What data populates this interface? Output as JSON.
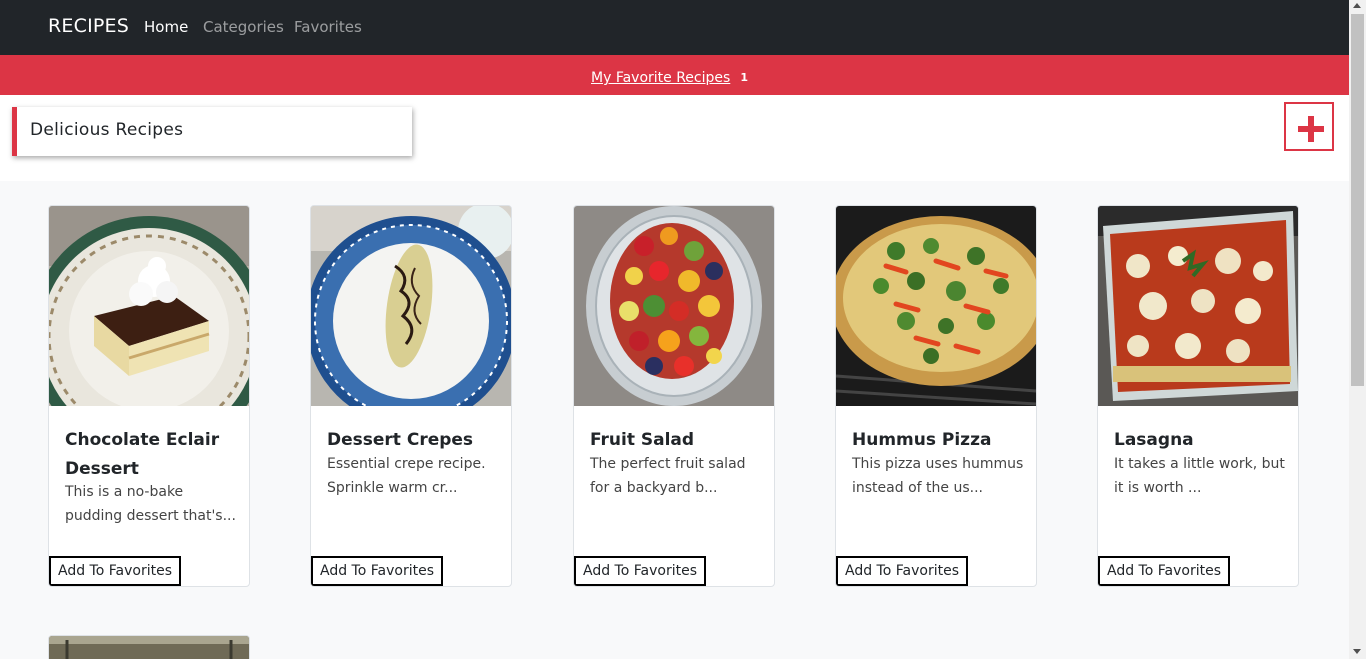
{
  "navbar": {
    "brand": "RECIPES",
    "links": [
      "Home",
      "Categories",
      "Favorites"
    ],
    "active": "Home"
  },
  "favorites_bar": {
    "link_label": "My Favorite Recipes",
    "count": "1"
  },
  "header": {
    "title": "Delicious Recipes",
    "add_icon": "plus-icon"
  },
  "recipes": [
    {
      "title": "Chocolate Eclair Dessert",
      "description": "This is a no-bake pudding dessert that's...",
      "button": "Add To Favorites",
      "image": "chocolate-eclair-dessert-photo"
    },
    {
      "title": "Dessert Crepes",
      "description": "Essential crepe recipe. Sprinkle warm cr...",
      "button": "Add To Favorites",
      "image": "dessert-crepes-photo"
    },
    {
      "title": "Fruit Salad",
      "description": "The perfect fruit salad for a backyard b...",
      "button": "Add To Favorites",
      "image": "fruit-salad-photo"
    },
    {
      "title": "Hummus Pizza",
      "description": "This pizza uses hummus instead of the us...",
      "button": "Add To Favorites",
      "image": "hummus-pizza-photo"
    },
    {
      "title": "Lasagna",
      "description": "It takes a little work, but it is worth ...",
      "button": "Add To Favorites",
      "image": "lasagna-photo"
    }
  ],
  "colors": {
    "navbar_bg": "#212529",
    "accent_red": "#dc3545",
    "page_bg": "#f8f9fa"
  }
}
